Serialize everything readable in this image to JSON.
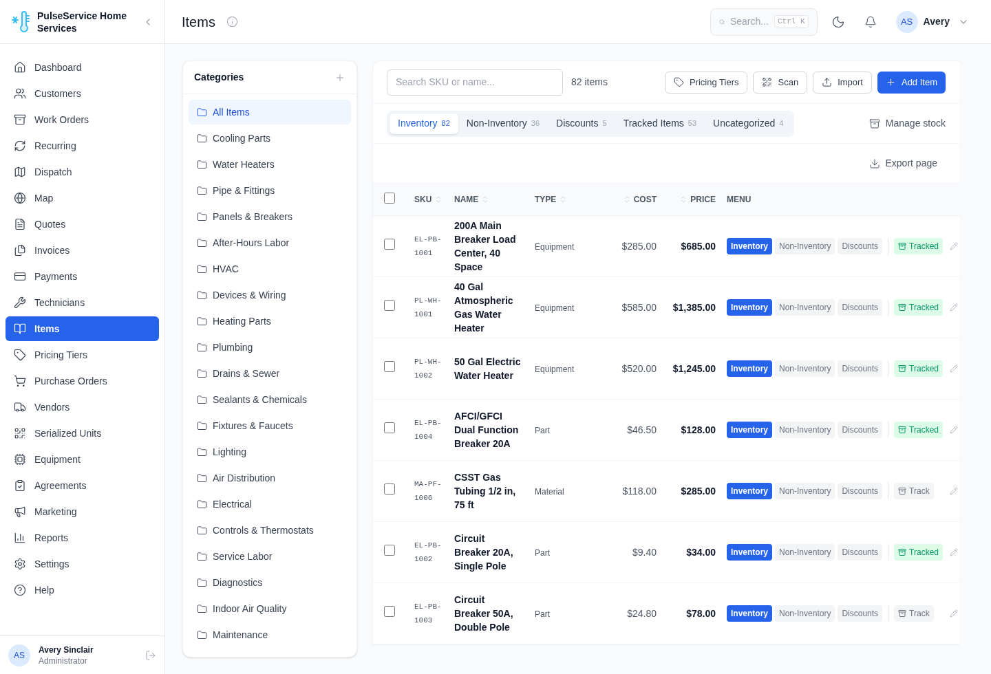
{
  "brand": {
    "name": "PulseService Home Services"
  },
  "header": {
    "title": "Items",
    "search": {
      "placeholder": "Search...",
      "shortcut": "Ctrl K"
    },
    "user": {
      "initials": "AS",
      "name": "Avery"
    }
  },
  "sidebar": {
    "items": [
      {
        "label": "Dashboard",
        "selected": false
      },
      {
        "label": "Customers",
        "selected": false
      },
      {
        "label": "Work Orders",
        "selected": false
      },
      {
        "label": "Recurring",
        "selected": false
      },
      {
        "label": "Dispatch",
        "selected": false
      },
      {
        "label": "Map",
        "selected": false
      },
      {
        "label": "Quotes",
        "selected": false
      },
      {
        "label": "Invoices",
        "selected": false
      },
      {
        "label": "Payments",
        "selected": false
      },
      {
        "label": "Technicians",
        "selected": false
      },
      {
        "label": "Items",
        "selected": true
      },
      {
        "label": "Pricing Tiers",
        "selected": false
      },
      {
        "label": "Purchase Orders",
        "selected": false
      },
      {
        "label": "Vendors",
        "selected": false
      },
      {
        "label": "Serialized Units",
        "selected": false
      },
      {
        "label": "Equipment",
        "selected": false
      },
      {
        "label": "Agreements",
        "selected": false
      },
      {
        "label": "Marketing",
        "selected": false
      },
      {
        "label": "Reports",
        "selected": false
      },
      {
        "label": "Settings",
        "selected": false
      },
      {
        "label": "Help",
        "selected": false
      }
    ],
    "user": {
      "initials": "AS",
      "name": "Avery Sinclair",
      "role": "Administrator"
    }
  },
  "categories": {
    "title": "Categories",
    "items": [
      {
        "label": "All Items",
        "selected": true
      },
      {
        "label": "Cooling Parts",
        "selected": false
      },
      {
        "label": "Water Heaters",
        "selected": false
      },
      {
        "label": "Pipe & Fittings",
        "selected": false
      },
      {
        "label": "Panels & Breakers",
        "selected": false
      },
      {
        "label": "After-Hours Labor",
        "selected": false
      },
      {
        "label": "HVAC",
        "selected": false
      },
      {
        "label": "Devices & Wiring",
        "selected": false
      },
      {
        "label": "Heating Parts",
        "selected": false
      },
      {
        "label": "Plumbing",
        "selected": false
      },
      {
        "label": "Drains & Sewer",
        "selected": false
      },
      {
        "label": "Sealants & Chemicals",
        "selected": false
      },
      {
        "label": "Fixtures & Faucets",
        "selected": false
      },
      {
        "label": "Lighting",
        "selected": false
      },
      {
        "label": "Air Distribution",
        "selected": false
      },
      {
        "label": "Electrical",
        "selected": false
      },
      {
        "label": "Controls & Thermostats",
        "selected": false
      },
      {
        "label": "Service Labor",
        "selected": false
      },
      {
        "label": "Diagnostics",
        "selected": false
      },
      {
        "label": "Indoor Air Quality",
        "selected": false
      },
      {
        "label": "Maintenance",
        "selected": false
      }
    ]
  },
  "toolbar": {
    "search_placeholder": "Search SKU or name...",
    "count": "82 items",
    "buttons": [
      {
        "label": "Pricing Tiers",
        "kind": "tag"
      },
      {
        "label": "Scan",
        "kind": "scan"
      },
      {
        "label": "Import",
        "kind": "import"
      },
      {
        "label": "Add Item",
        "kind": "add"
      }
    ]
  },
  "tabs": [
    {
      "label": "Inventory",
      "count": "82",
      "selected": true
    },
    {
      "label": "Non-Inventory",
      "count": "36",
      "selected": false
    },
    {
      "label": "Discounts",
      "count": "5",
      "selected": false
    },
    {
      "label": "Tracked Items",
      "count": "53",
      "selected": false
    },
    {
      "label": "Uncategorized",
      "count": "4",
      "selected": false
    }
  ],
  "manage_stock": "Manage stock",
  "export": "Export page",
  "table": {
    "select_all": false,
    "columns": [
      "SKU",
      "NAME",
      "TYPE",
      "COST",
      "PRICE",
      "MENU"
    ],
    "rows": [
      {
        "checked": false,
        "sku": "EL-PB-1001",
        "name": "200A Main Breaker Load Center, 40 Space",
        "type": "Equipment",
        "cost": "$285.00",
        "price": "$685.00",
        "menu": [
          {
            "label": "Inventory",
            "selected": true
          },
          {
            "label": "Non-Inventory",
            "selected": false
          },
          {
            "label": "Discounts",
            "selected": false
          }
        ],
        "track": {
          "label": "Tracked",
          "tracked": true
        }
      },
      {
        "checked": false,
        "sku": "PL-WH-1001",
        "name": "40 Gal Atmospheric Gas Water Heater",
        "type": "Equipment",
        "cost": "$585.00",
        "price": "$1,385.00",
        "menu": [
          {
            "label": "Inventory",
            "selected": true
          },
          {
            "label": "Non-Inventory",
            "selected": false
          },
          {
            "label": "Discounts",
            "selected": false
          }
        ],
        "track": {
          "label": "Tracked",
          "tracked": true
        }
      },
      {
        "checked": false,
        "sku": "PL-WH-1002",
        "name": "50 Gal Electric Water Heater",
        "type": "Equipment",
        "cost": "$520.00",
        "price": "$1,245.00",
        "menu": [
          {
            "label": "Inventory",
            "selected": true
          },
          {
            "label": "Non-Inventory",
            "selected": false
          },
          {
            "label": "Discounts",
            "selected": false
          }
        ],
        "track": {
          "label": "Tracked",
          "tracked": true
        }
      },
      {
        "checked": false,
        "sku": "EL-PB-1004",
        "name": "AFCI/GFCI Dual Function Breaker 20A",
        "type": "Part",
        "cost": "$46.50",
        "price": "$128.00",
        "menu": [
          {
            "label": "Inventory",
            "selected": true
          },
          {
            "label": "Non-Inventory",
            "selected": false
          },
          {
            "label": "Discounts",
            "selected": false
          }
        ],
        "track": {
          "label": "Tracked",
          "tracked": true
        }
      },
      {
        "checked": false,
        "sku": "MA-PF-1006",
        "name": "CSST Gas Tubing 1/2 in, 75 ft",
        "type": "Material",
        "cost": "$118.00",
        "price": "$285.00",
        "menu": [
          {
            "label": "Inventory",
            "selected": true
          },
          {
            "label": "Non-Inventory",
            "selected": false
          },
          {
            "label": "Discounts",
            "selected": false
          }
        ],
        "track": {
          "label": "Track",
          "tracked": false
        }
      },
      {
        "checked": false,
        "sku": "EL-PB-1002",
        "name": "Circuit Breaker 20A, Single Pole",
        "type": "Part",
        "cost": "$9.40",
        "price": "$34.00",
        "menu": [
          {
            "label": "Inventory",
            "selected": true
          },
          {
            "label": "Non-Inventory",
            "selected": false
          },
          {
            "label": "Discounts",
            "selected": false
          }
        ],
        "track": {
          "label": "Tracked",
          "tracked": true
        }
      },
      {
        "checked": false,
        "sku": "EL-PB-1003",
        "name": "Circuit Breaker 50A, Double Pole",
        "type": "Part",
        "cost": "$24.80",
        "price": "$78.00",
        "menu": [
          {
            "label": "Inventory",
            "selected": true
          },
          {
            "label": "Non-Inventory",
            "selected": false
          },
          {
            "label": "Discounts",
            "selected": false
          }
        ],
        "track": {
          "label": "Track",
          "tracked": false
        }
      }
    ]
  }
}
